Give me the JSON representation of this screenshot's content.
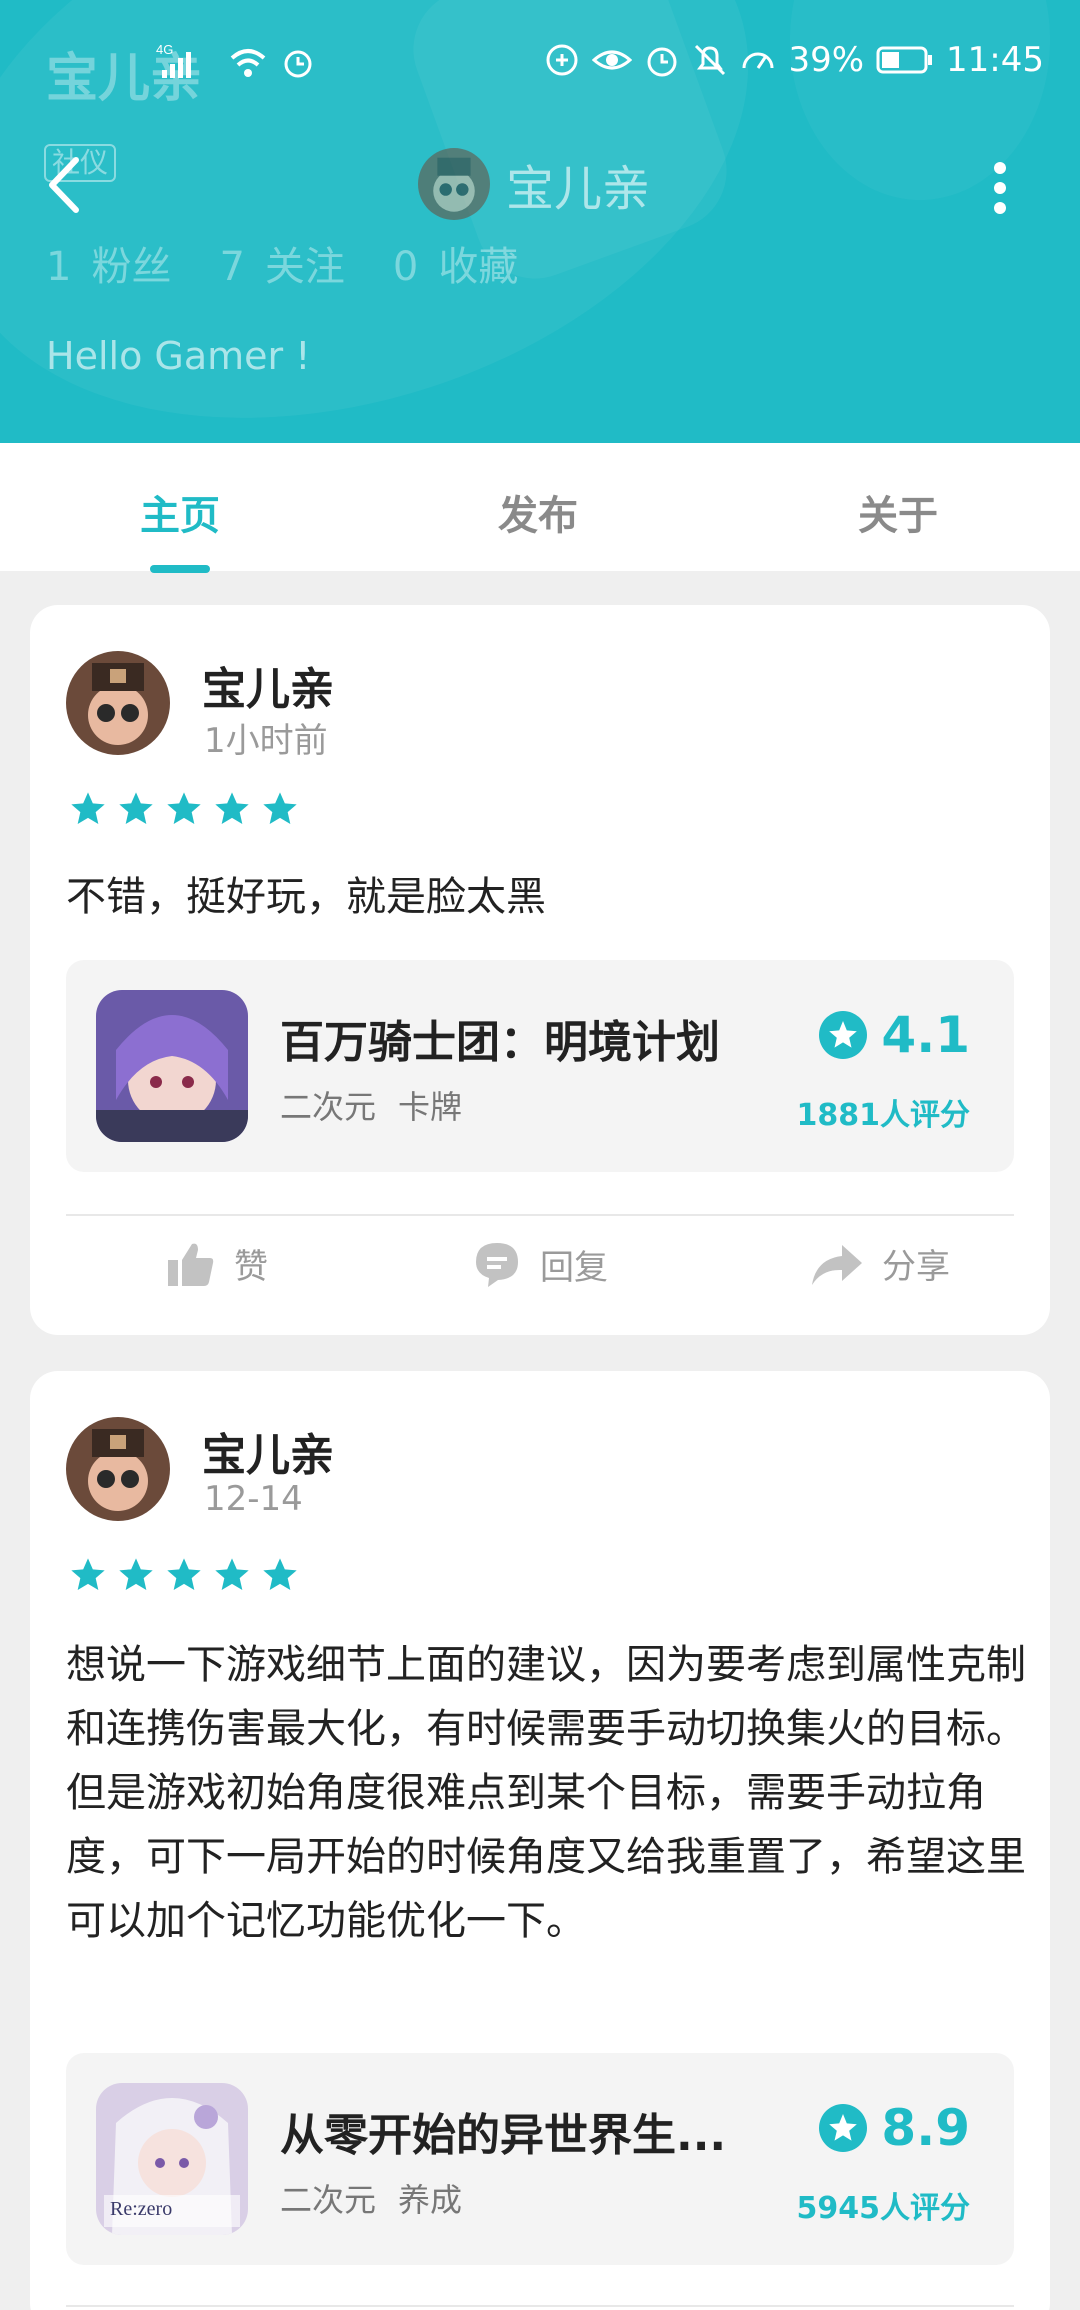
{
  "status_bar": {
    "network": "4G",
    "battery": "39%",
    "time": "11:45"
  },
  "profile": {
    "name": "宝儿亲",
    "tag": "社仪",
    "stats": [
      {
        "value": "1",
        "label": "粉丝"
      },
      {
        "value": "7",
        "label": "关注"
      },
      {
        "value": "0",
        "label": "收藏"
      }
    ],
    "bio": "Hello Gamer !"
  },
  "tabs": [
    {
      "label": "主页",
      "active": true
    },
    {
      "label": "发布",
      "active": false
    },
    {
      "label": "关于",
      "active": false
    }
  ],
  "posts": [
    {
      "user": "宝儿亲",
      "time": "1小时前",
      "rating": 5,
      "content": "不错，挺好玩，就是脸太黑",
      "game": {
        "title": "百万骑士团：明境计划",
        "tags": [
          "二次元",
          "卡牌"
        ],
        "score": "4.1",
        "count": "1881人评分"
      },
      "actions": {
        "like": "赞",
        "reply": "回复",
        "share": "分享"
      }
    },
    {
      "user": "宝儿亲",
      "time": "12-14",
      "rating": 5,
      "content": "想说一下游戏细节上面的建议，因为要考虑到属性克制和连携伤害最大化，有时候需要手动切换集火的目标。但是游戏初始角度很难点到某个目标，需要手动拉角度，可下一局开始的时候角度又给我重置了，希望这里可以加个记忆功能优化一下。",
      "game": {
        "title": "从零开始的异世界生...",
        "tags": [
          "二次元",
          "养成"
        ],
        "score": "8.9",
        "count": "5945人评分",
        "icon_text": "Re:zero"
      }
    }
  ],
  "colors": {
    "accent": "#20bbc6",
    "text": "#222222",
    "muted": "#9a9a9a"
  }
}
